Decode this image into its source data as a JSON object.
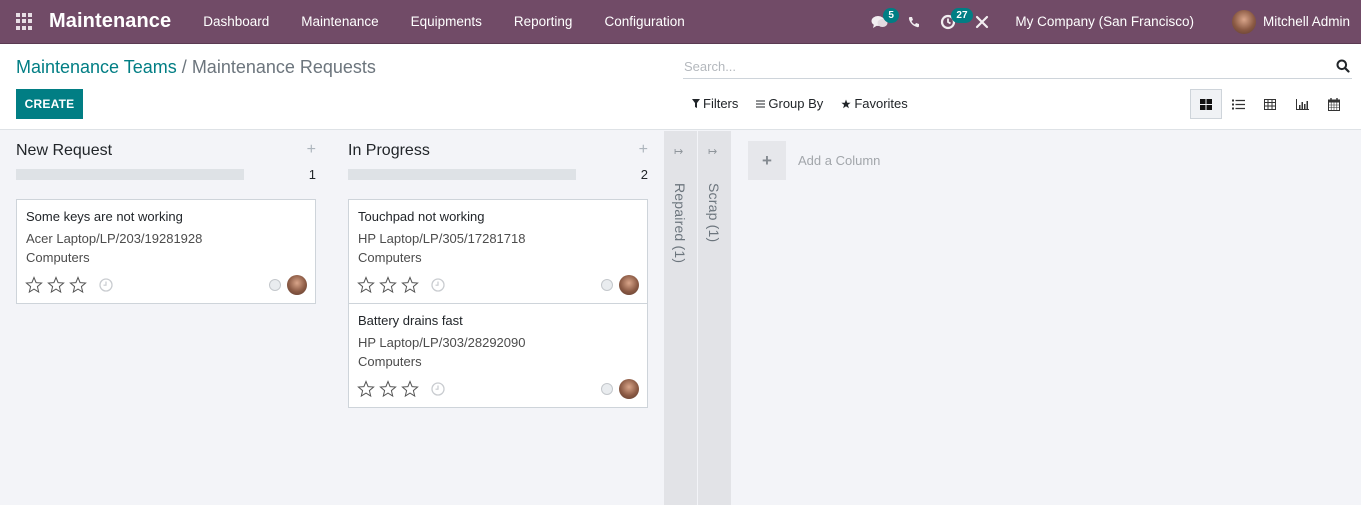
{
  "navbar": {
    "app_title": "Maintenance",
    "menu": [
      {
        "label": "Dashboard"
      },
      {
        "label": "Maintenance"
      },
      {
        "label": "Equipments"
      },
      {
        "label": "Reporting"
      },
      {
        "label": "Configuration"
      }
    ],
    "messages_count": "5",
    "activities_count": "27",
    "company": "My Company (San Francisco)",
    "user": "Mitchell Admin",
    "brand_color": "#714b67",
    "badge_color": "#017e84"
  },
  "control_panel": {
    "breadcrumb": {
      "parent": "Maintenance Teams",
      "separator": "/",
      "current": "Maintenance Requests"
    },
    "create_label": "CREATE",
    "search_placeholder": "Search...",
    "filters_label": "Filters",
    "group_by_label": "Group By",
    "favorites_label": "Favorites",
    "views": [
      {
        "name": "kanban",
        "active": true
      },
      {
        "name": "list",
        "active": false
      },
      {
        "name": "pivot",
        "active": false
      },
      {
        "name": "graph",
        "active": false
      },
      {
        "name": "calendar",
        "active": false
      }
    ]
  },
  "kanban": {
    "columns": [
      {
        "title": "New Request",
        "count": "1",
        "cards": [
          {
            "title": "Some keys are not working",
            "equipment": "Acer Laptop/LP/203/19281928",
            "category": "Computers",
            "priority_stars": 0
          }
        ]
      },
      {
        "title": "In Progress",
        "count": "2",
        "cards": [
          {
            "title": "Touchpad not working",
            "equipment": "HP Laptop/LP/305/17281718",
            "category": "Computers",
            "priority_stars": 0
          },
          {
            "title": "Battery drains fast",
            "equipment": "HP Laptop/LP/303/28292090",
            "category": "Computers",
            "priority_stars": 0
          }
        ]
      }
    ],
    "folded_columns": [
      {
        "label": "Repaired (1)"
      },
      {
        "label": "Scrap (1)"
      }
    ],
    "add_column_label": "Add a Column"
  }
}
